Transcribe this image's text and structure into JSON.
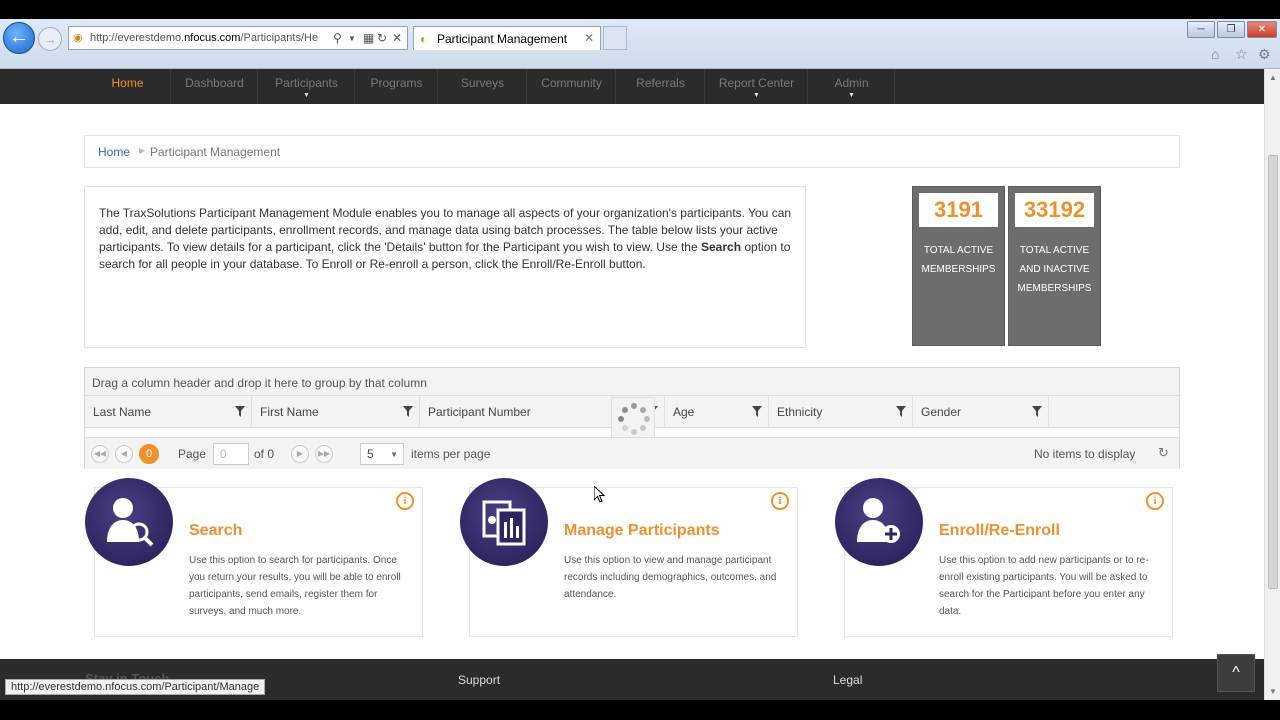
{
  "browser": {
    "url_prefix": "http://everestdemo.",
    "url_host": "nfocus.com",
    "url_rest": "/Participants/He",
    "tab_title": "Participant Management",
    "status_url": "http://everestdemo.nfocus.com/Participant/Manage"
  },
  "nav": {
    "items": [
      {
        "label": "Home"
      },
      {
        "label": "Dashboard"
      },
      {
        "label": "Participants"
      },
      {
        "label": "Programs"
      },
      {
        "label": "Surveys"
      },
      {
        "label": "Community"
      },
      {
        "label": "Referrals"
      },
      {
        "label": "Report Center"
      },
      {
        "label": "Admin"
      }
    ]
  },
  "breadcrumb": {
    "home": "Home",
    "current": "Participant Management"
  },
  "description": {
    "part1": "The TraxSolutions Participant Management Module enables you to manage all aspects of your organization's participants. You can add, edit, and delete participants, enrollment records, and manage data using batch processes. The table below lists your active participants. To view details for a participant, click the 'Details' button for the Participant you wish to view. Use the ",
    "bold": "Search",
    "part2": " option to search for all people in your database. To Enroll or Re-enroll a person, click the Enroll/Re-Enroll button."
  },
  "stats": [
    {
      "value": "3191",
      "label": "TOTAL ACTIVE MEMBERSHIPS"
    },
    {
      "value": "33192",
      "label": "TOTAL ACTIVE AND INACTIVE MEMBERSHIPS"
    }
  ],
  "grid": {
    "group_hint": "Drag a column header and drop it here to group by that column",
    "columns": [
      "Last Name",
      "First Name",
      "Participant Number",
      "Age",
      "Ethnicity",
      "Gender"
    ],
    "pager": {
      "current": "0",
      "page_label": "Page",
      "page_input": "0",
      "of_label": "of 0",
      "page_size": "5",
      "per_page_label": "items per page",
      "empty_text": "No items to display"
    }
  },
  "cards": [
    {
      "title": "Search",
      "text": "Use this option to search for participants. Once you return your results, you will be able to enroll participants, send emails, register them for surveys, and much more."
    },
    {
      "title": "Manage Participants",
      "text": "Use this option to view and manage participant records including demographics, outcomes, and attendance."
    },
    {
      "title": "Enroll/Re-Enroll",
      "text": "Use this option to add new participants or to re-enroll existing participants. You will be asked to search for the Participant before you enter any data."
    }
  ],
  "footer": {
    "stay": "Stay in Touch",
    "support": "Support",
    "legal": "Legal"
  },
  "colors": {
    "accent": "#f0902c",
    "nav_bg": "#2b2b2b",
    "stat_bg": "#6d6d6d",
    "card_icon": "#2f2566"
  }
}
